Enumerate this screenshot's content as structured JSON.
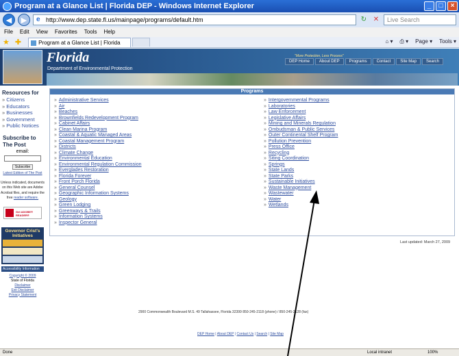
{
  "window": {
    "title": "Program at a Glance List | Florida DEP - Windows Internet Explorer",
    "minimize": "_",
    "maximize": "□",
    "close": "×"
  },
  "addressbar": {
    "url": "http://www.dep.state.fl.us/mainpage/programs/default.htm",
    "search_placeholder": "Live Search"
  },
  "menubar": {
    "items": [
      "File",
      "Edit",
      "View",
      "Favorites",
      "Tools",
      "Help"
    ]
  },
  "tabbar": {
    "tab_title": "Program at a Glance List | Florida DEP",
    "tools": [
      "Page ▾",
      "Tools ▾"
    ]
  },
  "banner": {
    "title": "Florida",
    "department": "Department of Environmental Protection",
    "slogan": "\"More Protection, Less Process\"",
    "nav": [
      "DEP Home",
      "About DEP",
      "Programs",
      "Contact",
      "Site Map",
      "Search"
    ]
  },
  "sidebar": {
    "resources_title": "Resources for",
    "resources": [
      "Citizens",
      "Educators",
      "Businesses",
      "Government",
      "Public Notices"
    ],
    "subscribe_title": "Subscribe to The Post",
    "email_label": "email:",
    "subscribe_button": "Subscribe",
    "latest_edition": "Latest Edition of The Post",
    "note": "Unless indicated, documents on this Web site are Adobe Acrobat files, and require the free",
    "note_link": "reader software.",
    "adobe": "Get ADOBE® READER®",
    "governor_title": "Governor Crist's Initiatives",
    "accessibility": "Accessibility Information",
    "copyright": "Copyright © 2009",
    "state": "State of Florida",
    "disclaimer": "Disclaimer",
    "exit_disclaimer": "Exit Disclaimer",
    "privacy": "Privacy Statement"
  },
  "programs": {
    "heading": "Programs",
    "left": [
      "Administrative Services",
      "Air",
      "Beaches",
      "Brownfields Redevelopment Program",
      "Cabinet Affairs",
      "Clean Marina Program",
      "Coastal & Aquatic Managed Areas",
      "Coastal Management Program",
      "Districts",
      "Climate Change",
      "Environmental Education",
      "Environmental Regulation Commission",
      "Everglades Restoration",
      "Florida Forever",
      "Front Porch Florida",
      "General Counsel",
      "Geographic Information Systems",
      "Geology",
      "Green Lodging",
      "Greenways & Trails",
      "Information Systems",
      "Inspector General"
    ],
    "right": [
      "Intergovernmental Programs",
      "Laboratories",
      "Law Enforcement",
      "Legislative Affairs",
      "Mining and Minerals Regulation",
      "Ombudsman & Public Services",
      "Outer Continental Shelf Program",
      "Pollution Prevention",
      "Press Office",
      "Recycling",
      "Siting Coordination",
      "Springs",
      "State Lands",
      "State Parks",
      "Sustainable Initiatives",
      "Waste Management",
      "Wastewater",
      "Water",
      "Wetlands"
    ]
  },
  "page": {
    "last_updated": "Last updated: March 27, 2009",
    "address": "2900 Commonwealth Boulevard M.S. 49 Tallahassee, Florida 32399 850-245-2118 (phone) / 850-245-2128 (fax)",
    "footer_links": [
      "DEP Home",
      "About DEP",
      "Contact Us",
      "Search",
      "Site Map"
    ]
  },
  "statusbar": {
    "status": "Done",
    "zone": "Local intranet",
    "zoom": "100%"
  },
  "colors": {
    "link": "#2f4fa0",
    "banner": "#1d3e6e",
    "panel_head": "#4a7ab5"
  }
}
